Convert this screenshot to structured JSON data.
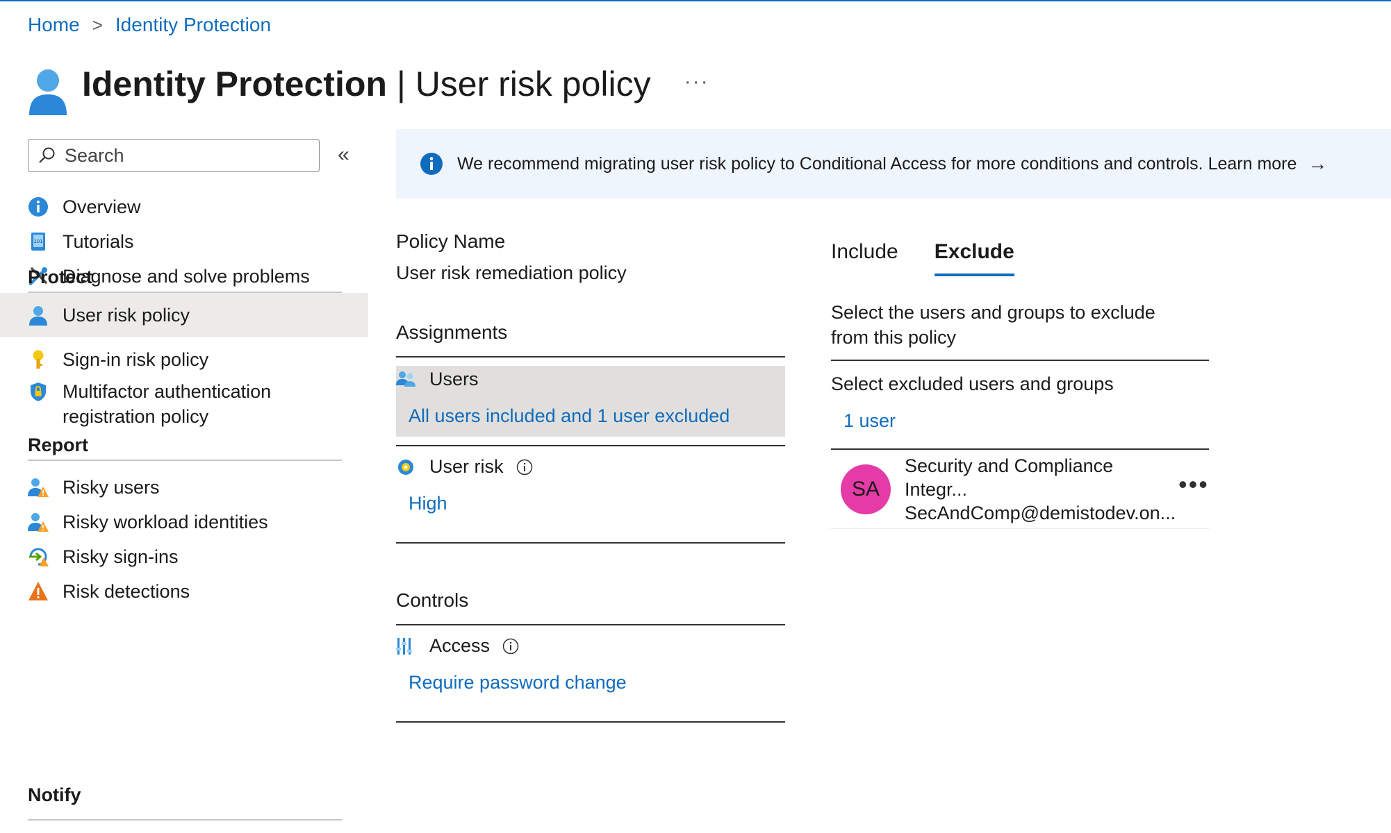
{
  "breadcrumb": {
    "home": "Home",
    "current": "Identity Protection",
    "separator": ">"
  },
  "header": {
    "title_strong": "Identity Protection",
    "title_rest": " | User risk policy",
    "more": "···"
  },
  "sidebar": {
    "search_placeholder": "Search",
    "collapse": "«",
    "top_items": [
      {
        "label": "Overview"
      },
      {
        "label": "Tutorials"
      },
      {
        "label": "Diagnose and solve problems"
      }
    ],
    "protect": {
      "title": "Protect",
      "items": [
        {
          "label": "User risk policy"
        },
        {
          "label": "Sign-in risk policy"
        },
        {
          "label_line1": "Multifactor authentication",
          "label_line2": "registration policy"
        }
      ]
    },
    "report": {
      "title": "Report",
      "items": [
        {
          "label": "Risky users"
        },
        {
          "label": "Risky workload identities"
        },
        {
          "label": "Risky sign-ins"
        },
        {
          "label": "Risk detections"
        }
      ]
    },
    "notify": {
      "title": "Notify"
    }
  },
  "banner": {
    "text": "We recommend migrating user risk policy to Conditional Access for more conditions and controls. Learn more",
    "arrow": "→"
  },
  "policy": {
    "name_label": "Policy Name",
    "name_value": "User risk remediation policy",
    "assignments_label": "Assignments",
    "users_label": "Users",
    "users_value": "All users included and 1 user excluded",
    "user_risk_label": "User risk",
    "user_risk_value": "High",
    "controls_label": "Controls",
    "access_label": "Access",
    "access_value": "Require password change"
  },
  "right": {
    "tabs": [
      {
        "label": "Include"
      },
      {
        "label": "Exclude"
      }
    ],
    "description": "Select the users and groups to exclude from this policy",
    "select_label": "Select excluded users and groups",
    "count_link": "1 user",
    "user": {
      "initials": "SA",
      "name": "Security and Compliance Integr...",
      "email": "SecAndComp@demistodev.on...",
      "more": "•••"
    }
  },
  "colors": {
    "accent": "#0f6cbd",
    "avatar": "#e43ba6",
    "selected_bg": "#e1dfdd",
    "banner_bg": "#eff5fc"
  }
}
